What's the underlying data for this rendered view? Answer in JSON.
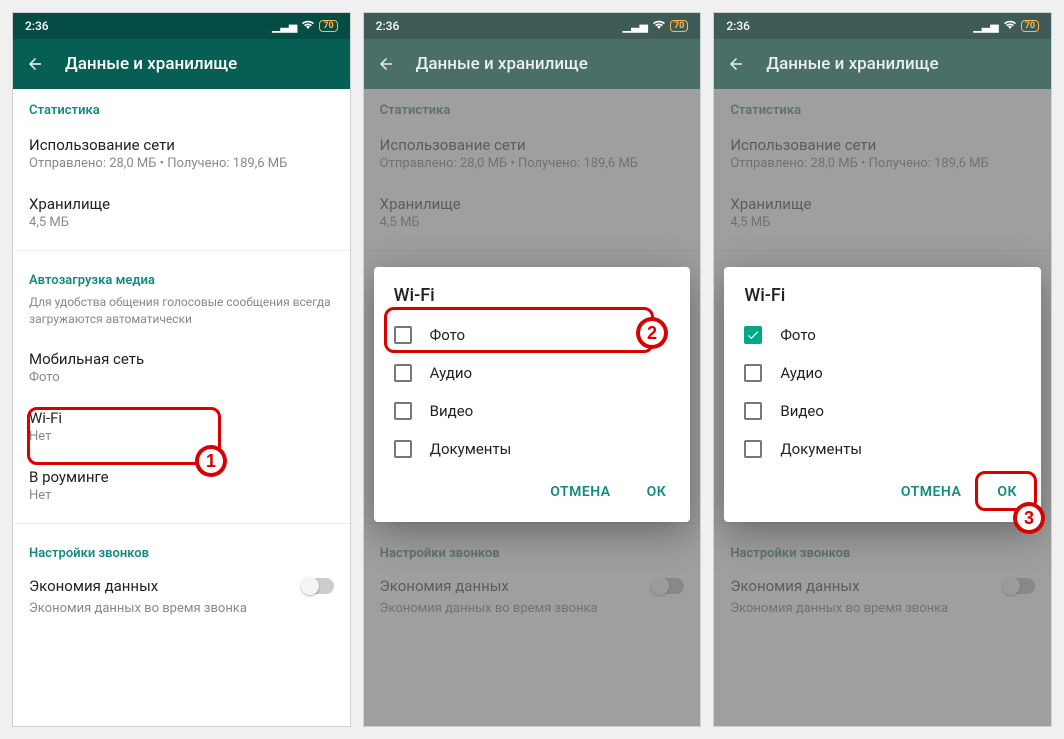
{
  "status": {
    "time": "2:36",
    "battery": "70"
  },
  "appbar": {
    "title": "Данные и хранилище"
  },
  "sections": {
    "stats_header": "Статистика",
    "network_usage_title": "Использование сети",
    "network_usage_sub": "Отправлено: 28,0 МБ • Получено: 189,6 МБ",
    "storage_title": "Хранилище",
    "storage_sub": "4,5 МБ",
    "autodl_header": "Автозагрузка медиа",
    "autodl_desc": "Для удобства общения голосовые сообщения всегда загружаются автоматически",
    "mobile_title": "Мобильная сеть",
    "mobile_sub": "Фото",
    "wifi_title": "Wi-Fi",
    "wifi_sub": "Нет",
    "roaming_title": "В роуминге",
    "roaming_sub": "Нет",
    "calls_header": "Настройки звонков",
    "econ_title": "Экономия данных",
    "econ_sub": "Экономия данных во время звонка"
  },
  "dialog": {
    "title": "Wi-Fi",
    "options": {
      "photo": "Фото",
      "audio": "Аудио",
      "video": "Видео",
      "docs": "Документы"
    },
    "cancel": "ОТМЕНА",
    "ok": "ОК"
  },
  "badges": {
    "1": "1",
    "2": "2",
    "3": "3"
  }
}
